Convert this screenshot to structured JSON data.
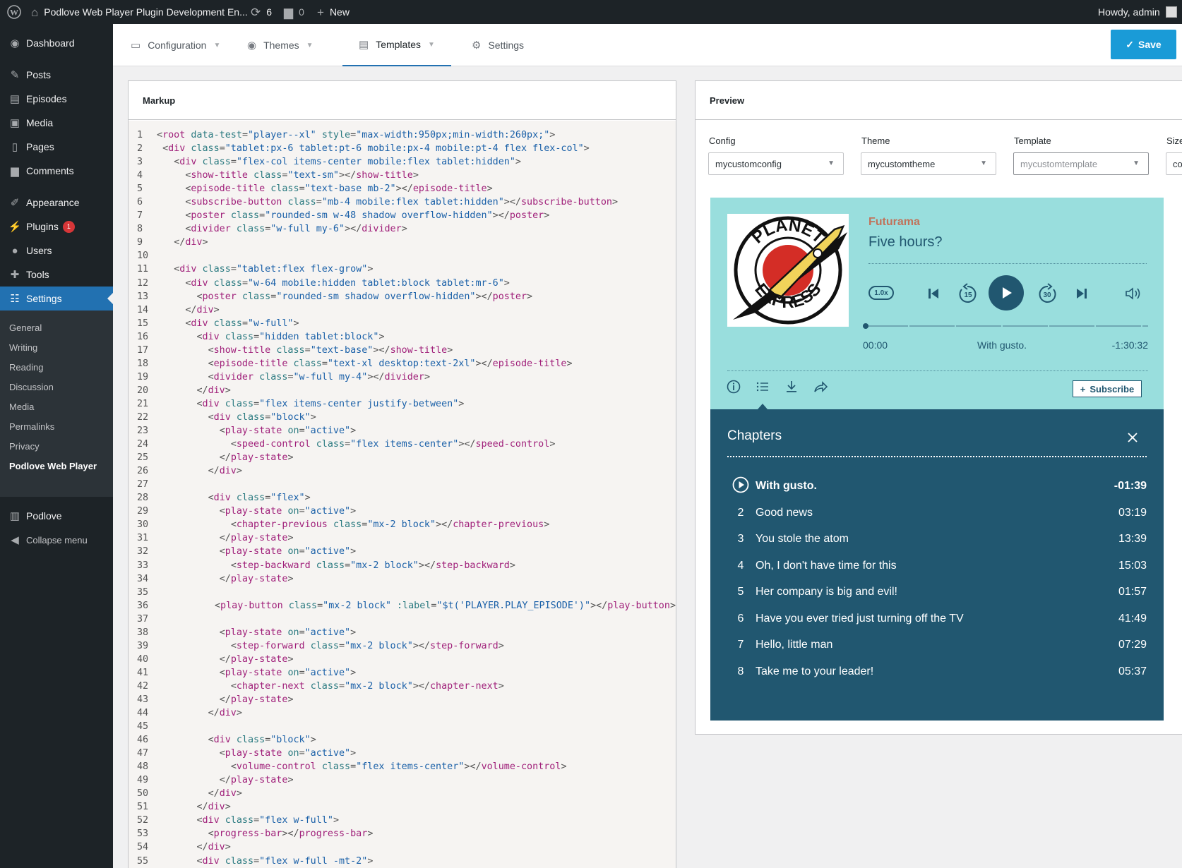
{
  "adminbar": {
    "site_title": "Podlove Web Player Plugin Development En...",
    "updates_count": "6",
    "comments_count": "0",
    "new_label": "New",
    "howdy": "Howdy, admin"
  },
  "menu": {
    "items": [
      {
        "label": "Dashboard",
        "icon": "dashboard-icon"
      },
      {
        "label": "Posts",
        "icon": "pin-icon"
      },
      {
        "label": "Episodes",
        "icon": "clapper-icon"
      },
      {
        "label": "Media",
        "icon": "media-icon"
      },
      {
        "label": "Pages",
        "icon": "page-icon"
      },
      {
        "label": "Comments",
        "icon": "comment-icon"
      },
      {
        "label": "Appearance",
        "icon": "brush-icon"
      },
      {
        "label": "Plugins",
        "icon": "plugin-icon",
        "badge": "1"
      },
      {
        "label": "Users",
        "icon": "user-icon"
      },
      {
        "label": "Tools",
        "icon": "wrench-icon"
      },
      {
        "label": "Settings",
        "icon": "settings-icon",
        "current": true
      }
    ],
    "submenu": [
      "General",
      "Writing",
      "Reading",
      "Discussion",
      "Media",
      "Permalinks",
      "Privacy",
      "Podlove Web Player"
    ],
    "podlove": "Podlove",
    "collapse": "Collapse menu"
  },
  "tabs": [
    {
      "label": "Configuration",
      "icon": "config-icon"
    },
    {
      "label": "Themes",
      "icon": "eye-icon"
    },
    {
      "label": "Templates",
      "icon": "document-icon",
      "active": true
    },
    {
      "label": "Settings",
      "icon": "gear-icon"
    }
  ],
  "save_label": "Save",
  "markup": {
    "title": "Markup",
    "lines": [
      "<root data-test=\"player--xl\" style=\"max-width:950px;min-width:260px;\">",
      " <div class=\"tablet:px-6 tablet:pt-6 mobile:px-4 mobile:pt-4 flex flex-col\">",
      "   <div class=\"flex-col items-center mobile:flex tablet:hidden\">",
      "     <show-title class=\"text-sm\"></show-title>",
      "     <episode-title class=\"text-base mb-2\"></episode-title>",
      "     <subscribe-button class=\"mb-4 mobile:flex tablet:hidden\"></subscribe-button>",
      "     <poster class=\"rounded-sm w-48 shadow overflow-hidden\"></poster>",
      "     <divider class=\"w-full my-6\"></divider>",
      "   </div>",
      "",
      "   <div class=\"tablet:flex flex-grow\">",
      "     <div class=\"w-64 mobile:hidden tablet:block tablet:mr-6\">",
      "       <poster class=\"rounded-sm shadow overflow-hidden\"></poster>",
      "     </div>",
      "     <div class=\"w-full\">",
      "       <div class=\"hidden tablet:block\">",
      "         <show-title class=\"text-base\"></show-title>",
      "         <episode-title class=\"text-xl desktop:text-2xl\"></episode-title>",
      "         <divider class=\"w-full my-4\"></divider>",
      "       </div>",
      "       <div class=\"flex items-center justify-between\">",
      "         <div class=\"block\">",
      "           <play-state on=\"active\">",
      "             <speed-control class=\"flex items-center\"></speed-control>",
      "           </play-state>",
      "         </div>",
      "",
      "         <div class=\"flex\">",
      "           <play-state on=\"active\">",
      "             <chapter-previous class=\"mx-2 block\"></chapter-previous>",
      "           </play-state>",
      "           <play-state on=\"active\">",
      "             <step-backward class=\"mx-2 block\"></step-backward>",
      "           </play-state>",
      "",
      "           <play-button class=\"mx-2 block\" :label=\"$t('PLAYER.PLAY_EPISODE')\"></play-button>",
      "",
      "           <play-state on=\"active\">",
      "             <step-forward class=\"mx-2 block\"></step-forward>",
      "           </play-state>",
      "           <play-state on=\"active\">",
      "             <chapter-next class=\"mx-2 block\"></chapter-next>",
      "           </play-state>",
      "         </div>",
      "",
      "         <div class=\"block\">",
      "           <play-state on=\"active\">",
      "             <volume-control class=\"flex items-center\"></volume-control>",
      "           </play-state>",
      "         </div>",
      "       </div>",
      "       <div class=\"flex w-full\">",
      "         <progress-bar></progress-bar>",
      "       </div>",
      "       <div class=\"flex w-full -mt-2\">"
    ]
  },
  "preview": {
    "title": "Preview",
    "config_label": "Config",
    "config_value": "mycustomconfig",
    "theme_label": "Theme",
    "theme_value": "mycustomtheme",
    "template_label": "Template",
    "template_value": "mycustomtemplate",
    "size_label": "Size",
    "size_value": "co"
  },
  "player": {
    "show_title": "Futurama",
    "episode_title": "Five hours?",
    "speed": "1.0x",
    "back_seconds": "15",
    "forward_seconds": "30",
    "time_current": "00:00",
    "chapter_current": "With gusto.",
    "time_remaining": "-1:30:32",
    "progress": 0,
    "subscribe_label": "Subscribe",
    "poster_text_top": "PLANET",
    "poster_text_bottom": "EXPRESS",
    "colors": {
      "background": "#99dedd",
      "dark": "#215770",
      "show_title": "#c0735b"
    }
  },
  "chapters": {
    "title": "Chapters",
    "items": [
      {
        "num": "",
        "title": "With gusto.",
        "duration": "-01:39",
        "active": true
      },
      {
        "num": "2",
        "title": "Good news",
        "duration": "03:19"
      },
      {
        "num": "3",
        "title": "You stole the atom",
        "duration": "13:39"
      },
      {
        "num": "4",
        "title": "Oh, I don't have time for this",
        "duration": "15:03"
      },
      {
        "num": "5",
        "title": "Her company is big and evil!",
        "duration": "01:57"
      },
      {
        "num": "6",
        "title": "Have you ever tried just turning off the TV",
        "duration": "41:49"
      },
      {
        "num": "7",
        "title": "Hello, little man",
        "duration": "07:29"
      },
      {
        "num": "8",
        "title": "Take me to your leader!",
        "duration": "05:37"
      }
    ]
  }
}
